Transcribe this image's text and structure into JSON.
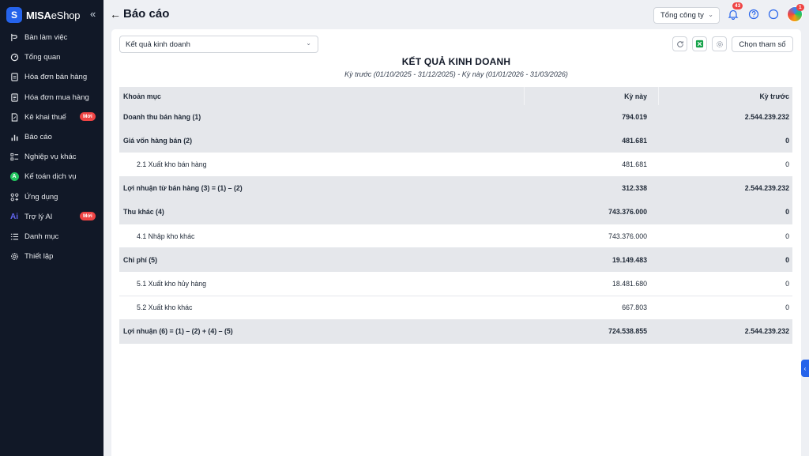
{
  "sidebar": {
    "brand_bold": "MISA",
    "brand_rest": "eShop",
    "collapse": "«",
    "items": [
      {
        "label": "Bàn làm việc",
        "icon": "workflow-icon"
      },
      {
        "label": "Tổng quan",
        "icon": "gauge-icon"
      },
      {
        "label": "Hóa đơn bán hàng",
        "icon": "invoice-icon"
      },
      {
        "label": "Hóa đơn mua hàng",
        "icon": "receipt-icon"
      },
      {
        "label": "Kê khai thuế",
        "icon": "tax-file-icon",
        "badge": "Mới"
      },
      {
        "label": "Báo cáo",
        "icon": "bar-chart-icon"
      },
      {
        "label": "Nghiệp vụ khác",
        "icon": "checklist-icon"
      },
      {
        "label": "Kế toán dịch vụ",
        "icon": "accounting-service-icon"
      },
      {
        "label": "Ứng dụng",
        "icon": "apps-icon"
      },
      {
        "label": "Trợ lý AI",
        "icon": "ai-icon",
        "badge": "Mới"
      },
      {
        "label": "Danh mục",
        "icon": "list-icon"
      },
      {
        "label": "Thiết lập",
        "icon": "settings-icon"
      }
    ]
  },
  "header": {
    "title": "Báo cáo",
    "company": "Tổng công ty",
    "notification_count": "43",
    "avatar_badge": "1"
  },
  "report": {
    "selected": "Kết quả kinh doanh",
    "params_button": "Chọn tham số",
    "title": "KẾT QUẢ KINH DOANH",
    "subtitle": "Kỳ trước (01/10/2025 - 31/12/2025) - Kỳ này (01/01/2026 - 31/03/2026)",
    "columns": [
      "Khoản mục",
      "Kỳ này",
      "Kỳ trước"
    ],
    "rows": [
      {
        "label": "Doanh thu bán hàng (1)",
        "current": "794.019",
        "previous": "2.544.239.232",
        "type": "group"
      },
      {
        "label": "Giá vốn hàng bán (2)",
        "current": "481.681",
        "previous": "0",
        "type": "group"
      },
      {
        "label": "2.1 Xuất kho bán hàng",
        "current": "481.681",
        "previous": "0",
        "type": "detail"
      },
      {
        "label": "Lợi nhuận từ bán hàng (3) = (1) – (2)",
        "current": "312.338",
        "previous": "2.544.239.232",
        "type": "group"
      },
      {
        "label": "Thu khác (4)",
        "current": "743.376.000",
        "previous": "0",
        "type": "group"
      },
      {
        "label": "4.1 Nhập kho khác",
        "current": "743.376.000",
        "previous": "0",
        "type": "detail"
      },
      {
        "label": "Chi phí (5)",
        "current": "19.149.483",
        "previous": "0",
        "type": "group"
      },
      {
        "label": "5.1 Xuất kho hủy hàng",
        "current": "18.481.680",
        "previous": "0",
        "type": "detail"
      },
      {
        "label": "5.2 Xuất kho khác",
        "current": "667.803",
        "previous": "0",
        "type": "detail"
      },
      {
        "label": "Lợi nhuận (6) = (1) – (2) + (4) – (5)",
        "current": "724.538.855",
        "previous": "2.544.239.232",
        "type": "group"
      }
    ]
  }
}
